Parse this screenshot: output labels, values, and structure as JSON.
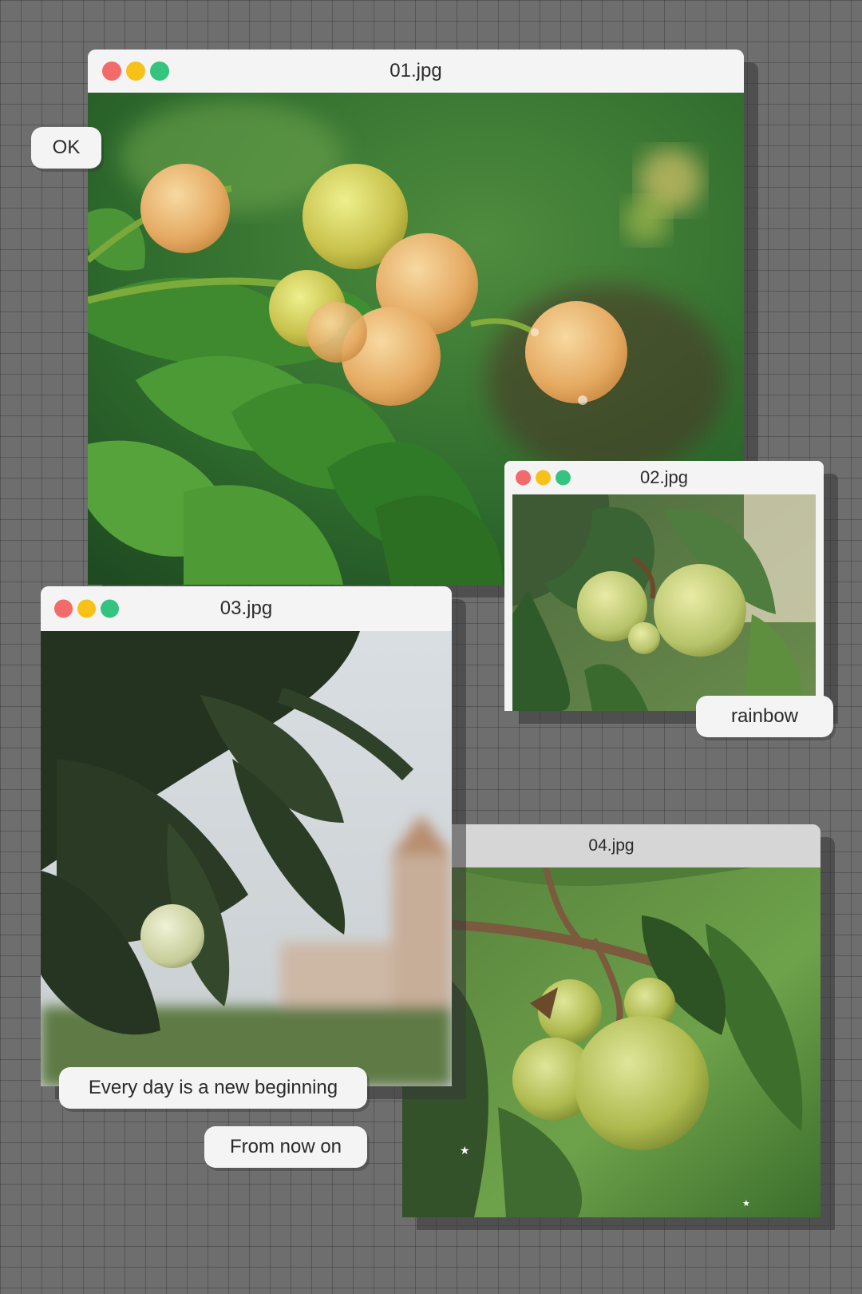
{
  "colors": {
    "red": "#f26a6a",
    "yellow": "#f6c21a",
    "green": "#35c47f"
  },
  "windows": {
    "w1": {
      "title": "01.jpg"
    },
    "w2": {
      "title": "02.jpg"
    },
    "w3": {
      "title": "03.jpg"
    },
    "w4": {
      "title": "04.jpg"
    }
  },
  "labels": {
    "ok": "OK",
    "rainbow": "rainbow",
    "every_day": "Every day is a new beginning",
    "from_now": "From now on"
  }
}
